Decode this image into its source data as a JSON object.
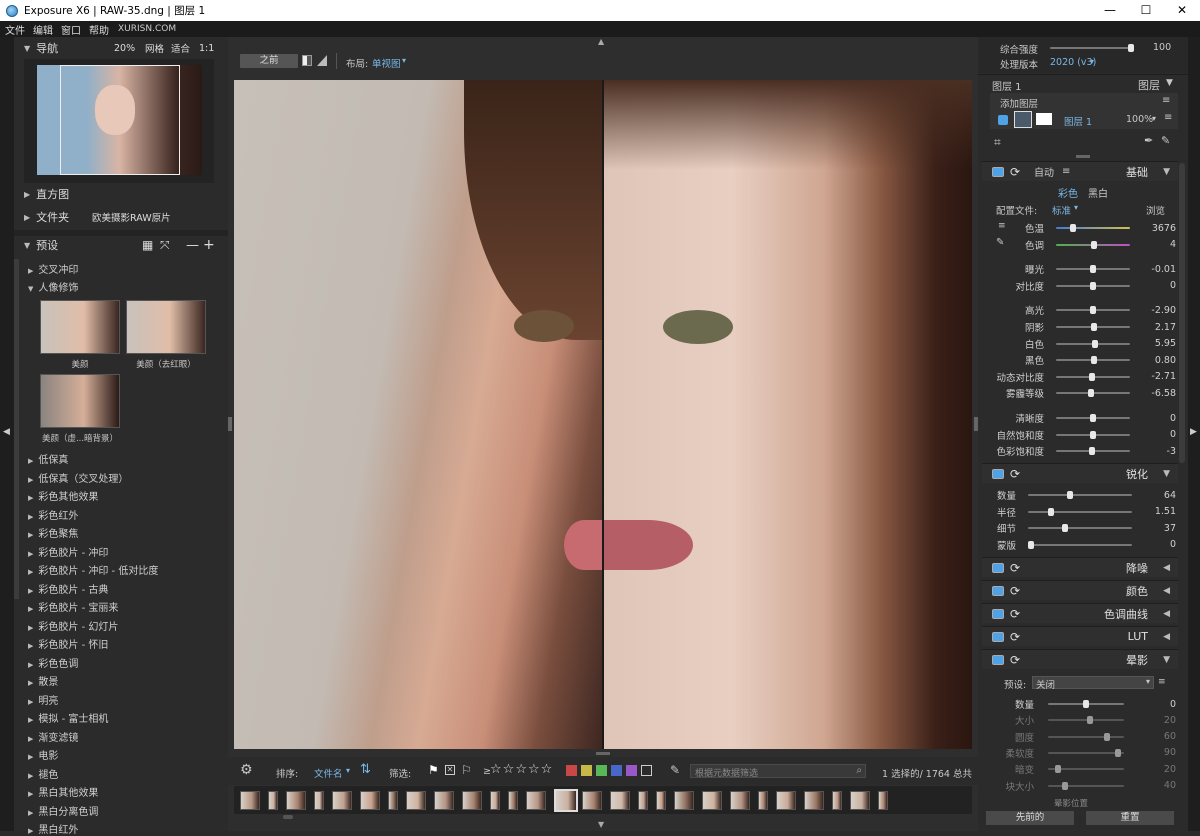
{
  "window": {
    "title": "Exposure X6 | RAW-35.dng | 图层 1",
    "min": "—",
    "max": "☐",
    "close": "✕"
  },
  "menu": {
    "items": [
      "文件",
      "编辑",
      "窗口",
      "帮助"
    ],
    "watermark": "XURISN.COM"
  },
  "nav": {
    "title": "导航",
    "zoom": "20%",
    "grid": "网格",
    "fit": "适合",
    "one": "1:1"
  },
  "histogram": {
    "title": "直方图"
  },
  "folder": {
    "title": "文件夹",
    "value": "欧美摄影RAW原片"
  },
  "presets": {
    "title": "预设",
    "group1": "交叉冲印",
    "group2": "人像修饰",
    "thumbs": [
      "美颜",
      "美颜（去红眼）",
      "美颜（虚...暗背景）"
    ],
    "list": [
      "低保真",
      "低保真（交叉处理）",
      "彩色其他效果",
      "彩色红外",
      "彩色聚焦",
      "彩色胶片 - 冲印",
      "彩色胶片 - 冲印 - 低对比度",
      "彩色胶片 - 古典",
      "彩色胶片 - 宝丽来",
      "彩色胶片 - 幻灯片",
      "彩色胶片 - 怀旧",
      "彩色色调",
      "散景",
      "明亮",
      "模拟 - 富士相机",
      "渐变滤镜",
      "电影",
      "褪色",
      "黑白其他效果",
      "黑白分离色调",
      "黑白红外"
    ]
  },
  "viewer": {
    "before": "之前",
    "layout_label": "布局:",
    "layout_value": "单视图"
  },
  "filmbar": {
    "sort_label": "排序:",
    "sort_value": "文件名",
    "filter_label": "筛选:",
    "gte": "≥",
    "search_placeholder": "根据元数据筛选",
    "count": "1 选择的/ 1764 总共",
    "color_labels": [
      "#c84848",
      "#c8b848",
      "#58b858",
      "#4868c8",
      "#9858c8"
    ]
  },
  "right": {
    "intensity_label": "综合强度",
    "intensity_value": "100",
    "intensity": 1.0,
    "process_label": "处理版本",
    "process_value": "2020 (v3)",
    "layers_current": "图层 1",
    "layers_title": "图层",
    "add_layer": "添加图层",
    "layer_name": "图层 1",
    "layer_opacity": "100%",
    "basic": {
      "title": "基础",
      "auto": "自动",
      "color": "彩色",
      "bw": "黑白",
      "profile_label": "配置文件:",
      "profile_value": "标准",
      "browse": "浏览",
      "sliders": [
        {
          "label": "色温",
          "value": "3676",
          "pos": 0.2
        },
        {
          "label": "色调",
          "value": "4",
          "pos": 0.52
        },
        {
          "label": "曝光",
          "value": "-0.01",
          "pos": 0.5
        },
        {
          "label": "对比度",
          "value": "0",
          "pos": 0.5
        },
        {
          "label": "高光",
          "value": "-2.90",
          "pos": 0.5
        },
        {
          "label": "阴影",
          "value": "2.17",
          "pos": 0.52
        },
        {
          "label": "白色",
          "value": "5.95",
          "pos": 0.53
        },
        {
          "label": "黑色",
          "value": "0.80",
          "pos": 0.51
        },
        {
          "label": "动态对比度",
          "value": "-2.71",
          "pos": 0.49
        },
        {
          "label": "雾霾等级",
          "value": "-6.58",
          "pos": 0.47
        },
        {
          "label": "清晰度",
          "value": "0",
          "pos": 0.5
        },
        {
          "label": "自然饱和度",
          "value": "0",
          "pos": 0.5
        },
        {
          "label": "色彩饱和度",
          "value": "-3",
          "pos": 0.49
        }
      ]
    },
    "sharpen": {
      "title": "锐化",
      "sliders": [
        {
          "label": "数量",
          "value": "64",
          "pos": 0.4
        },
        {
          "label": "半径",
          "value": "1.51",
          "pos": 0.2
        },
        {
          "label": "细节",
          "value": "37",
          "pos": 0.35
        },
        {
          "label": "蒙版",
          "value": "0",
          "pos": 0.0
        }
      ]
    },
    "tools": [
      "降噪",
      "颜色",
      "色调曲线",
      "LUT",
      "晕影"
    ],
    "vignette": {
      "preset_label": "预设:",
      "preset_value": "关闭",
      "sliders": [
        {
          "label": "数量",
          "value": "0",
          "pos": 0.5,
          "enabled": true
        },
        {
          "label": "大小",
          "value": "20",
          "pos": 0.55,
          "enabled": false
        },
        {
          "label": "圆度",
          "value": "60",
          "pos": 0.8,
          "enabled": false
        },
        {
          "label": "柔软度",
          "value": "90",
          "pos": 0.95,
          "enabled": false
        },
        {
          "label": "暗变",
          "value": "20",
          "pos": 0.1,
          "enabled": false
        },
        {
          "label": "块大小",
          "value": "40",
          "pos": 0.2,
          "enabled": false
        }
      ],
      "position": "晕影位置"
    },
    "prev": "先前的",
    "reset": "重置"
  }
}
